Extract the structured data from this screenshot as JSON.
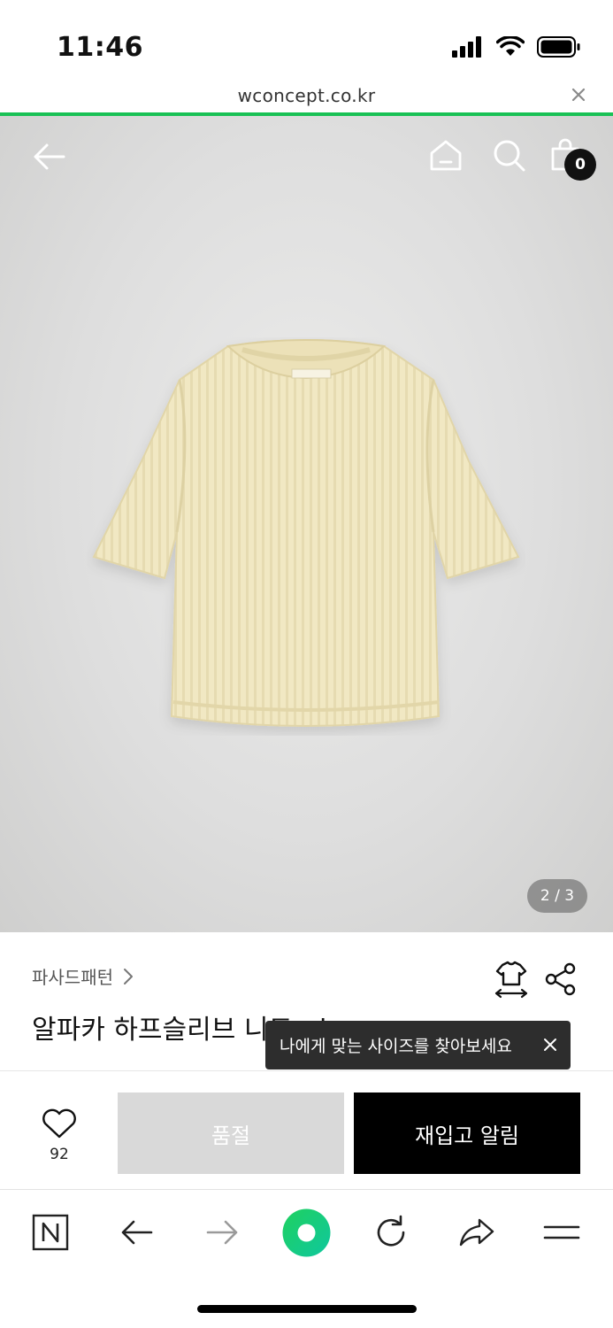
{
  "status_bar": {
    "time": "11:46"
  },
  "url_bar": {
    "url": "wconcept.co.kr"
  },
  "header": {
    "cart_count": "0"
  },
  "gallery": {
    "indicator": "2 / 3"
  },
  "product": {
    "brand": "파사드패턴",
    "title": "알파카 하프슬리브 니트 - i"
  },
  "tooltip": {
    "text": "나에게 맞는 사이즈를 찾아보세요"
  },
  "actions": {
    "like_count": "92",
    "soldout_label": "품절",
    "restock_label": "재입고 알림"
  },
  "colors": {
    "progress": "#19c155",
    "browser_green": "#19c155",
    "soldout_bg": "#d9d9d9",
    "primary_bg": "#000000"
  }
}
